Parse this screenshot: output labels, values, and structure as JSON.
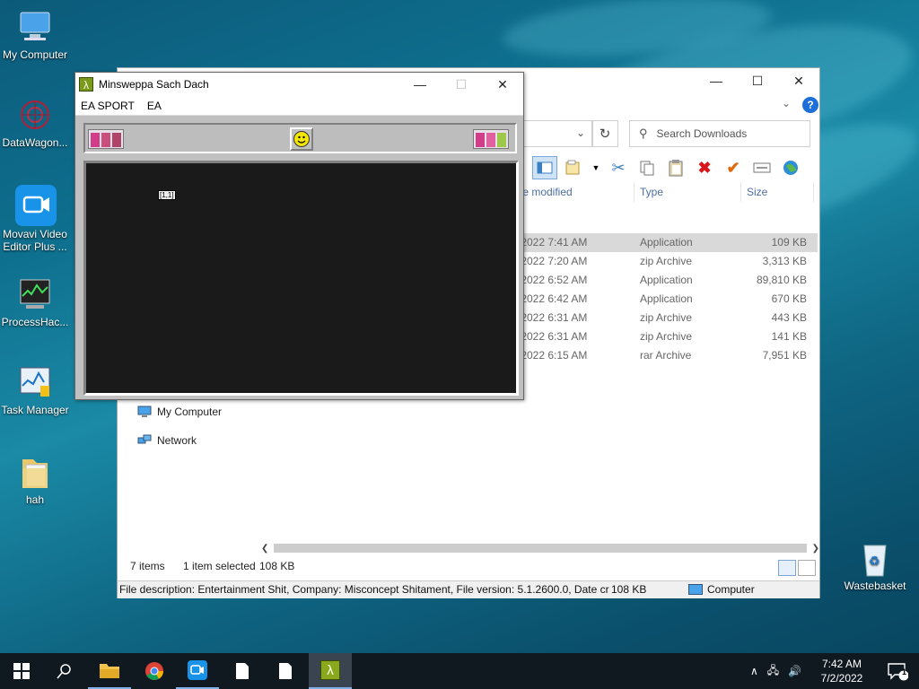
{
  "desktop": {
    "icons": [
      {
        "label": "My Computer"
      },
      {
        "label": "DataWagon..."
      },
      {
        "label": "Movavi Video Editor Plus ..."
      },
      {
        "label": "ProcessHac..."
      },
      {
        "label": "Task Manager"
      },
      {
        "label": "hah"
      },
      {
        "label": "Wastebasket"
      }
    ]
  },
  "explorer": {
    "search_placeholder": "Search Downloads",
    "columns": {
      "date": "te modified",
      "type": "Type",
      "size": "Size"
    },
    "rows": [
      {
        "date": "/2022 7:41 AM",
        "type": "Application",
        "size": "109 KB",
        "selected": true
      },
      {
        "date": "/2022 7:20 AM",
        "type": "zip Archive",
        "size": "3,313 KB"
      },
      {
        "date": "/2022 6:52 AM",
        "type": "Application",
        "size": "89,810 KB"
      },
      {
        "date": "/2022 6:42 AM",
        "type": "Application",
        "size": "670 KB"
      },
      {
        "date": "/2022 6:31 AM",
        "type": "zip Archive",
        "size": "443 KB"
      },
      {
        "date": "/2022 6:31 AM",
        "type": "zip Archive",
        "size": "141 KB"
      },
      {
        "date": "/2022 6:15 AM",
        "type": "rar Archive",
        "size": "7,951 KB"
      }
    ],
    "nav": {
      "my_computer": "My Computer",
      "network": "Network"
    },
    "status": {
      "items": "7 items",
      "selected": "1 item selected",
      "size": "108 KB"
    },
    "description": {
      "text": "File description: Entertainment Shit, Company: Misconcept Shitament, File version: 5.1.2600.0, Date crea",
      "size": "108 KB",
      "zone": "Computer"
    }
  },
  "minesweeper": {
    "title": "Minsweppa Sach Dach",
    "menu": [
      "EA SPORT",
      "EA"
    ],
    "cell_marker": "[1,1]"
  },
  "taskbar": {
    "time": "7:42 AM",
    "date": "7/2/2022",
    "notification_count": "1"
  }
}
